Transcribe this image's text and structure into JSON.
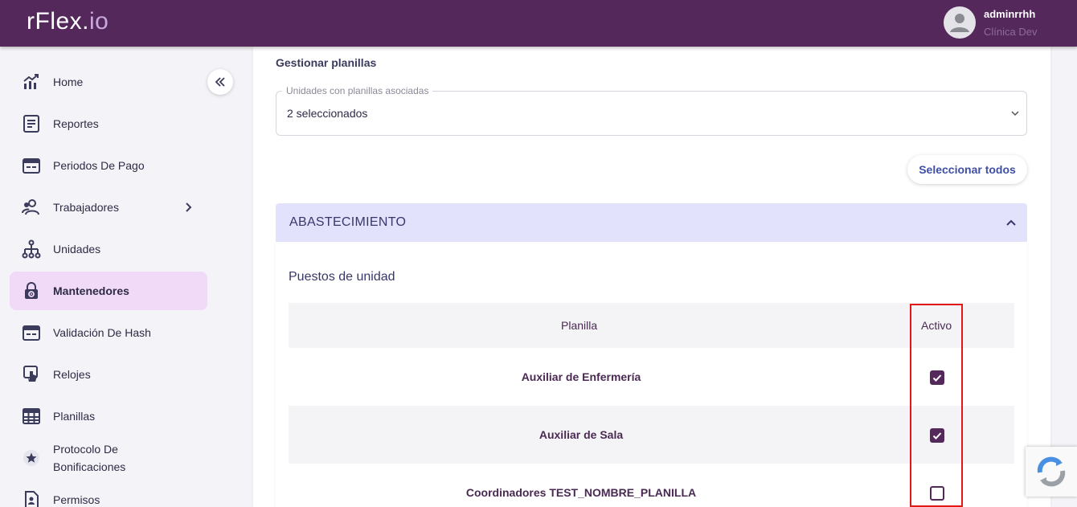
{
  "app": {
    "logo_main": "rFlex.",
    "logo_suffix": "io"
  },
  "user": {
    "name": "adminrrhh",
    "organization": "Clínica Dev"
  },
  "sidebar": {
    "items": [
      {
        "label": "Home",
        "icon": "chart-icon",
        "active": false
      },
      {
        "label": "Reportes",
        "icon": "document-icon",
        "active": false
      },
      {
        "label": "Periodos De Pago",
        "icon": "calendar-card-icon",
        "active": false
      },
      {
        "label": "Trabajadores",
        "icon": "users-icon",
        "active": false,
        "has_submenu": true
      },
      {
        "label": "Unidades",
        "icon": "org-tree-icon",
        "active": false
      },
      {
        "label": "Mantenedores",
        "icon": "lock-gear-icon",
        "active": true
      },
      {
        "label": "Validación De Hash",
        "icon": "calendar-card-icon",
        "active": false
      },
      {
        "label": "Relojes",
        "icon": "touch-clock-icon",
        "active": false
      },
      {
        "label": "Planillas",
        "icon": "table-grid-icon",
        "active": false
      },
      {
        "label": "Protocolo De Bonificaciones",
        "icon": "star-badge-icon",
        "active": false
      },
      {
        "label": "Permisos",
        "icon": "permission-doc-icon",
        "active": false
      }
    ]
  },
  "main": {
    "section_title": "Gestionar planillas",
    "units_select": {
      "label": "Unidades con planillas asociadas",
      "value": "2 seleccionados"
    },
    "select_all_label": "Seleccionar todos",
    "accordion": {
      "title": "ABASTECIMIENTO",
      "subtitle": "Puestos de unidad",
      "table": {
        "headers": [
          "Planilla",
          "Activo"
        ],
        "rows": [
          {
            "name": "Auxiliar de Enfermería",
            "active": true
          },
          {
            "name": "Auxiliar de Sala",
            "active": true
          },
          {
            "name": "Coordinadores TEST_NOMBRE_PLANILLA",
            "active": false
          }
        ]
      }
    }
  },
  "colors": {
    "topbar": "#55285c",
    "accent": "#55285c",
    "accordion_bg": "#e3e2fc",
    "active_nav_bg": "#f0daf8",
    "highlight_box": "#e01818",
    "link_button": "#3f4fa3"
  }
}
